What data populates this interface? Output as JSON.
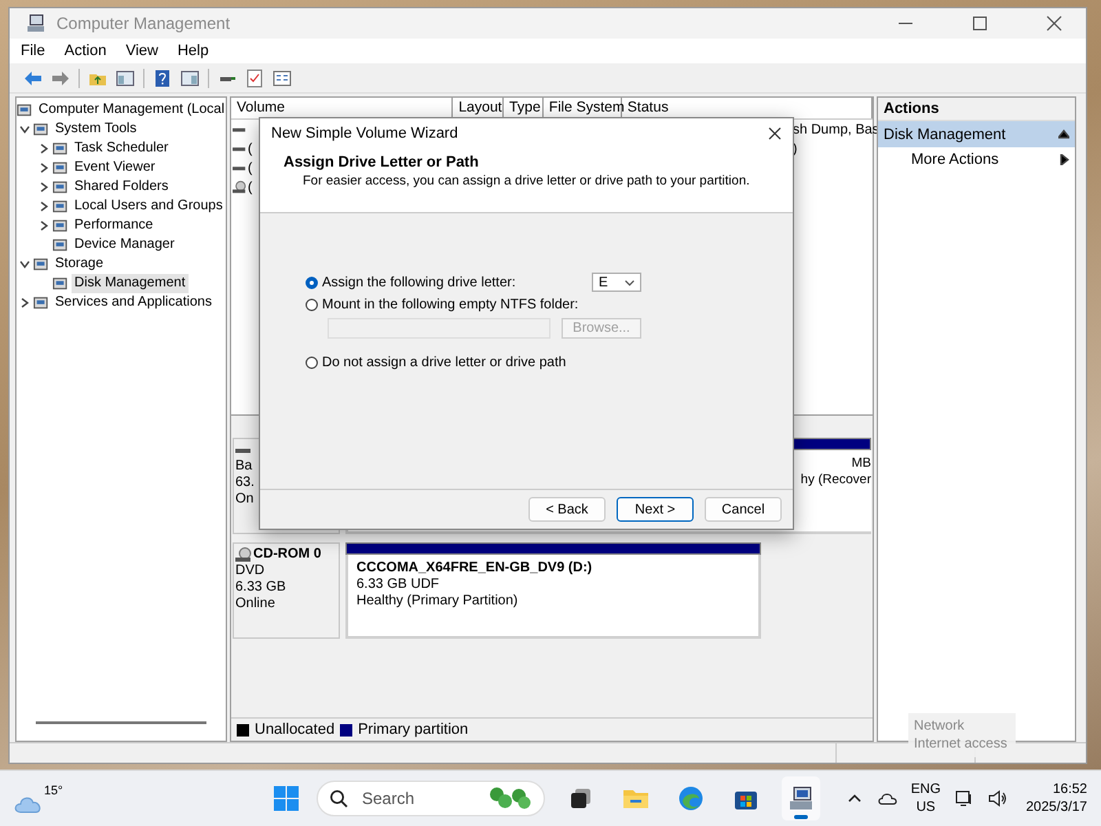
{
  "window": {
    "title": "Computer Management"
  },
  "menu": [
    "File",
    "Action",
    "View",
    "Help"
  ],
  "tree": [
    {
      "label": "Computer Management (Local",
      "selected": false,
      "children": [
        {
          "label": "System Tools",
          "expanded": true,
          "selected": false,
          "children": [
            {
              "label": "Task Scheduler",
              "expanded": false,
              "selected": false
            },
            {
              "label": "Event Viewer",
              "expanded": false,
              "selected": false
            },
            {
              "label": "Shared Folders",
              "expanded": false,
              "selected": false
            },
            {
              "label": "Local Users and Groups",
              "expanded": false,
              "selected": false
            },
            {
              "label": "Performance",
              "expanded": false,
              "selected": false
            },
            {
              "label": "Device Manager",
              "selected": false
            }
          ]
        },
        {
          "label": "Storage",
          "expanded": true,
          "selected": false,
          "children": [
            {
              "label": "Disk Management",
              "selected": true
            }
          ]
        },
        {
          "label": "Services and Applications",
          "expanded": false,
          "selected": false
        }
      ]
    }
  ],
  "volume_list": {
    "columns": [
      "Volume",
      "Layout",
      "Type",
      "File System",
      "Status"
    ],
    "rows": [
      {
        "kind": "disk",
        "status": "sh Dump, Bas"
      },
      {
        "kind": "disk",
        "volume": "(",
        "status": ")"
      },
      {
        "kind": "disk",
        "volume": "("
      },
      {
        "kind": "cdrom",
        "volume": "("
      }
    ]
  },
  "disks": [
    {
      "kind": "disk",
      "info": [
        "Ba",
        "63.",
        "On"
      ],
      "partition": {
        "lines": [
          "MB",
          "hy (Recover"
        ]
      }
    },
    {
      "kind": "cdrom",
      "name": "CD-ROM 0",
      "info": [
        "DVD",
        "6.33 GB",
        "Online"
      ],
      "partition": {
        "title": "CCCOMA_X64FRE_EN-GB_DV9  (D:)",
        "lines": [
          "6.33 GB UDF",
          "Healthy (Primary Partition)"
        ]
      }
    }
  ],
  "legend": [
    {
      "label": "Unallocated",
      "color": "#000000"
    },
    {
      "label": "Primary partition",
      "color": "#000080"
    }
  ],
  "actions": {
    "title": "Actions",
    "section": "Disk Management",
    "items": [
      "More Actions"
    ]
  },
  "dialog": {
    "title": "New Simple Volume Wizard",
    "heading": "Assign Drive Letter or Path",
    "subtitle": "For easier access, you can assign a drive letter or drive path to your partition.",
    "options": [
      {
        "label": "Assign the following drive letter:",
        "selected": true
      },
      {
        "label": "Mount in the following empty NTFS folder:",
        "selected": false
      },
      {
        "label": "Do not assign a drive letter or drive path",
        "selected": false
      }
    ],
    "drive_letter": "E",
    "folder_field": {
      "disabled": true
    },
    "browse_button": {
      "label": "Browse...",
      "disabled": true
    },
    "buttons": [
      {
        "label": "< Back",
        "default": false
      },
      {
        "label": "Next >",
        "default": true
      },
      {
        "label": "Cancel",
        "default": false
      }
    ]
  },
  "tooltip": {
    "lines": [
      "Network",
      "Internet access"
    ]
  },
  "taskbar": {
    "weather": "15°",
    "search": {
      "placeholder": "Search"
    },
    "apps": [
      {
        "kind": "taskview",
        "active": false
      },
      {
        "kind": "explorer",
        "active": false
      },
      {
        "kind": "browser",
        "active": false
      },
      {
        "kind": "store",
        "active": false
      },
      {
        "kind": "computer",
        "active": true
      }
    ],
    "language": [
      "ENG",
      "US"
    ],
    "time": "16:52",
    "date": "2025/3/17"
  }
}
